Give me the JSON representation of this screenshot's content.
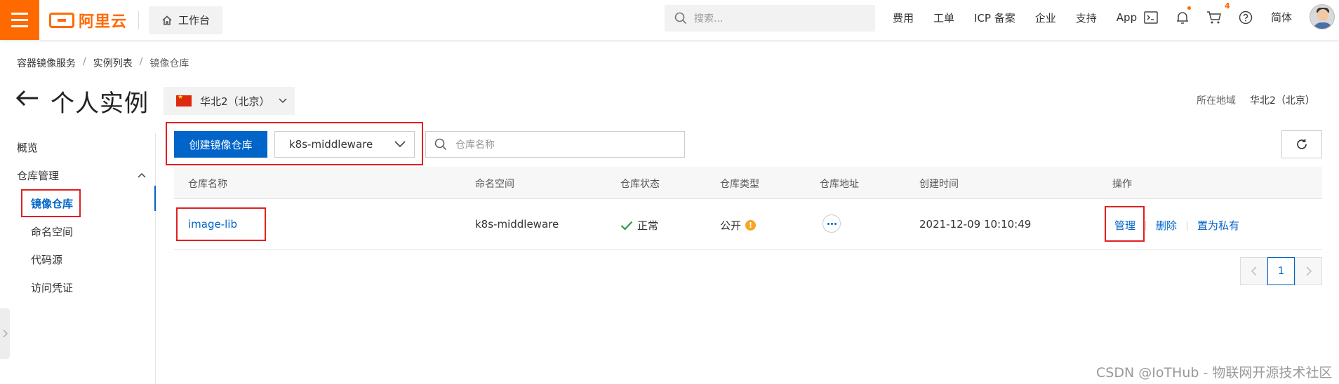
{
  "topbar": {
    "logo_text": "阿里云",
    "workbench_label": "工作台",
    "search_placeholder": "搜索...",
    "links": [
      "费用",
      "工单",
      "ICP 备案",
      "企业",
      "支持",
      "App"
    ],
    "cart_count": "4",
    "language": "简体"
  },
  "breadcrumb": [
    "容器镜像服务",
    "实例列表",
    "镜像仓库"
  ],
  "page": {
    "title": "个人实例",
    "region_selected": "华北2（北京）",
    "region_info_label": "所在地域",
    "region_info_value": "华北2（北京）"
  },
  "sidenav": {
    "overview": "概览",
    "repo_management": "仓库管理",
    "items": [
      "镜像仓库",
      "命名空间",
      "代码源",
      "访问凭证"
    ]
  },
  "toolbar": {
    "create_button": "创建镜像仓库",
    "namespace_selected": "k8s-middleware",
    "search_placeholder": "仓库名称"
  },
  "table": {
    "headers": [
      "仓库名称",
      "命名空间",
      "仓库状态",
      "仓库类型",
      "仓库地址",
      "创建时间",
      "操作"
    ],
    "rows": [
      {
        "name": "image-lib",
        "namespace": "k8s-middleware",
        "status": "正常",
        "type": "公开",
        "created": "2021-12-09 10:10:49",
        "actions": [
          "管理",
          "删除",
          "置为私有"
        ]
      }
    ]
  },
  "pagination": {
    "current_page": "1"
  },
  "watermark": "CSDN @IoTHub - 物联网开源技术社区",
  "colors": {
    "brand": "#ff6a00",
    "primary": "#0064c8",
    "highlight_box": "#e02020",
    "status_ok": "#2e9e3f",
    "warn": "#f5a623"
  }
}
